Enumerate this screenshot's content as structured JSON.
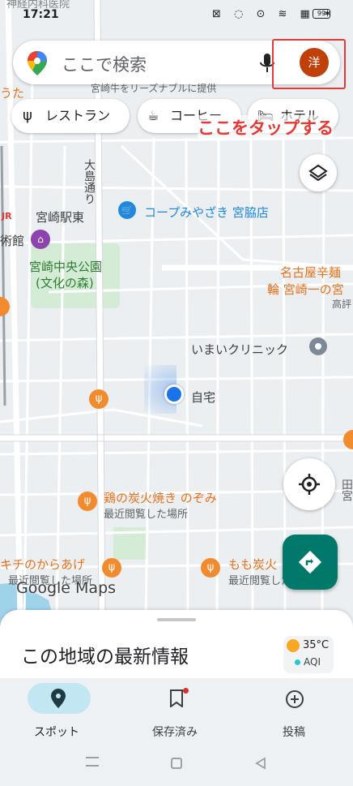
{
  "status": {
    "time": "17:21",
    "battery": "99",
    "overlay_text": "神経内科医院"
  },
  "search": {
    "placeholder": "ここで検索",
    "avatar_letter": "洋"
  },
  "chips": [
    {
      "label": "レストラン"
    },
    {
      "label": "コーヒー"
    },
    {
      "label": "ホテル"
    }
  ],
  "annotation": {
    "text": "ここをタップする",
    "color": "#e53935"
  },
  "map": {
    "places": {
      "station": "宮崎駅東",
      "street": "大島通り",
      "coop": "コープみやざき 宮脇店",
      "park_line1": "宮崎中央公園",
      "park_line2": "(文化の森)",
      "museum": "術館",
      "jr": "JR",
      "top_banner": "宮崎牛をリーズナブルに提供",
      "top_left": "うた",
      "nagoya_line1": "名古屋辛麺",
      "nagoya_line2": "輪 宮崎一の宮",
      "nagoya_line3": "高評",
      "imai": "いまいクリニック",
      "home": "自宅",
      "tori_name": "鶏の炭火焼き のぞみ",
      "tori_sub": "最近閲覧した場所",
      "kichi_name": "キチのからあげ",
      "kichi_sub": "最近閲覧した場所",
      "momo_name": "もも炭火",
      "momo_sub": "最近閲覧した場所",
      "right_edge": "田宮"
    },
    "watermark": "Google Maps"
  },
  "sheet": {
    "title": "この地域の最新情報",
    "temp": "35°C",
    "aqi": "AQI"
  },
  "bottom_nav": [
    {
      "label": "スポット",
      "active": true
    },
    {
      "label": "保存済み"
    },
    {
      "label": "投稿"
    }
  ],
  "colors": {
    "accent": "#1a73e8",
    "teal": "#00796b",
    "nav_active": "#c2e7f2",
    "poi_orange": "#f28b2e",
    "poi_blue": "#1e88e5",
    "avatar": "#c0400a"
  }
}
